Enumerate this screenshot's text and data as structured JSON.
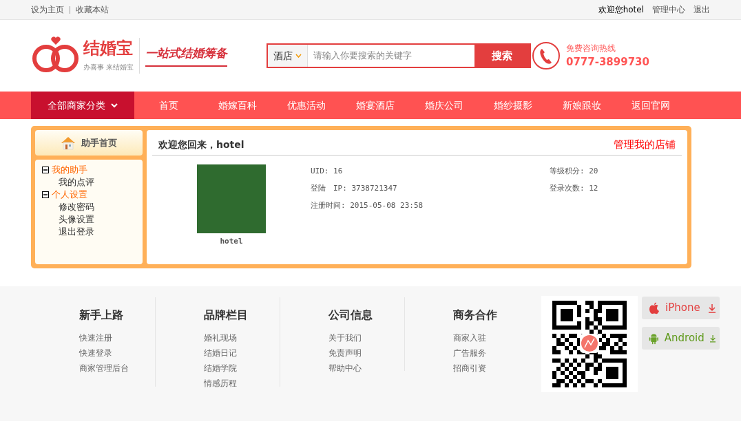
{
  "top_bar": {
    "left_links": [
      "设为主页",
      "收藏本站"
    ],
    "welcome": "欢迎您hotel",
    "right_links": [
      "管理中心",
      "退出"
    ]
  },
  "header": {
    "logo": {
      "name": "结婚宝",
      "tagline": "办喜事 来结婚宝",
      "slogan": "一站式结婚筹备"
    },
    "search": {
      "category": "酒店",
      "placeholder": "请输入你要搜索的关键字",
      "button": "搜索"
    },
    "hotline": {
      "label": "免费咨询热线",
      "number": "0777-3899730"
    }
  },
  "nav": [
    {
      "label": "全部商家分类",
      "kind": "category"
    },
    {
      "label": "首页",
      "kind": "link"
    },
    {
      "label": "婚嫁百科",
      "kind": "link"
    },
    {
      "label": "优惠活动",
      "kind": "link"
    },
    {
      "label": "婚宴酒店",
      "kind": "link"
    },
    {
      "label": "婚庆公司",
      "kind": "link"
    },
    {
      "label": "婚纱摄影",
      "kind": "link"
    },
    {
      "label": "新娘跟妆",
      "kind": "link"
    },
    {
      "label": "返回官网",
      "kind": "link"
    }
  ],
  "sidebar": {
    "home": "助手首页",
    "groups": [
      {
        "label": "我的助手",
        "expanded": true,
        "children": [
          {
            "label": "我的点评"
          }
        ]
      },
      {
        "label": "个人设置",
        "expanded": true,
        "children": [
          {
            "label": "修改密码"
          },
          {
            "label": "头像设置"
          },
          {
            "label": "退出登录"
          }
        ]
      }
    ]
  },
  "panel": {
    "title": "欢迎您回来，hotel",
    "manage_link": "管理我的店铺",
    "username": "hotel",
    "info_left": [
      "UID: 16",
      "登陆　IP: 3738721347",
      "注册时间: 2015-05-08 23:58"
    ],
    "info_right": [
      "等级积分: 20",
      "登录次数: 12"
    ]
  },
  "footer": {
    "columns": [
      {
        "heading": "新手上路",
        "links": [
          "快速注册",
          "快速登录",
          "商家管理后台"
        ]
      },
      {
        "heading": "品牌栏目",
        "links": [
          "婚礼现场",
          "结婚日记",
          "结婚学院",
          "情感历程"
        ]
      },
      {
        "heading": "公司信息",
        "links": [
          "关于我们",
          "免责声明",
          "帮助中心"
        ]
      },
      {
        "heading": "商务合作",
        "links": [
          "商家入驻",
          "广告服务",
          "招商引资"
        ]
      }
    ],
    "apps": [
      {
        "label": "iPhone",
        "kind": "ios"
      },
      {
        "label": "Android",
        "kind": "android"
      }
    ]
  }
}
